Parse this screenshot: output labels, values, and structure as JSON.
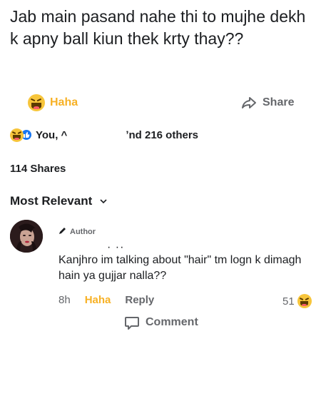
{
  "post": {
    "text": "Jab main pasand nahe thi to mujhe dekh k apny ball kiun thek krty thay??"
  },
  "actions": {
    "haha_label": "Haha",
    "comment_label": "Comment",
    "share_label": "Share"
  },
  "reactions": {
    "names_left": "You, ^",
    "names_right": "ʼnd 216 others"
  },
  "shares": {
    "label": "114 Shares"
  },
  "sort": {
    "label": "Most Relevant"
  },
  "comment": {
    "author_tag": "Author",
    "dots": "·  ··",
    "text": "Kanjhro im talking about \"hair\" tm logn k dimagh hain ya gujjar nalla??",
    "time": "8h",
    "haha_label": "Haha",
    "reply_label": "Reply",
    "reaction_count": "51"
  },
  "colors": {
    "haha_accent": "#f7b125",
    "muted": "#65676b",
    "like_blue": "#1877f2"
  }
}
